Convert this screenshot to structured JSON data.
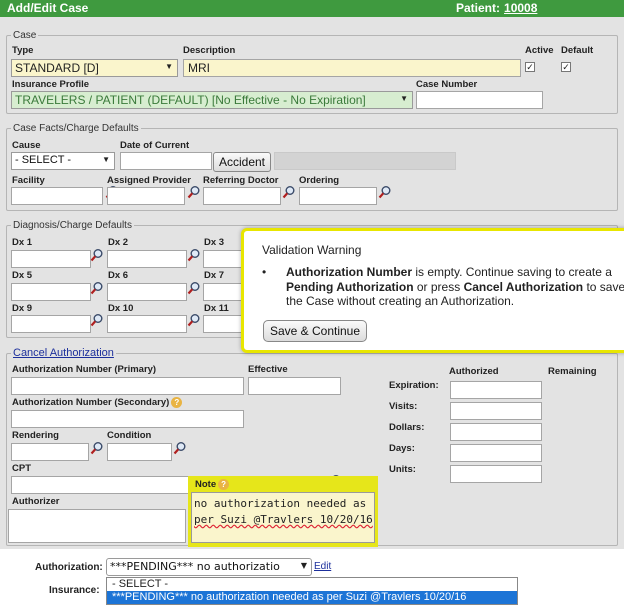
{
  "header": {
    "title": "Add/Edit Case",
    "patient_label": "Patient:",
    "patient_id": "10008"
  },
  "case": {
    "legend": "Case",
    "type_label": "Type",
    "type_value": "STANDARD [D]",
    "description_label": "Description",
    "description_value": "MRI",
    "active_label": "Active",
    "default_label": "Default",
    "active_checked": true,
    "default_checked": true,
    "insurance_profile_label": "Insurance Profile",
    "insurance_profile_value": "TRAVELERS / PATIENT (DEFAULT) [No Effective - No Expiration]",
    "case_number_label": "Case Number",
    "case_number_value": ""
  },
  "facts": {
    "legend": "Case Facts/Charge Defaults",
    "cause_label": "Cause",
    "cause_value": "- SELECT -",
    "date_of_current_label": "Date of Current",
    "accident_button": "Accident",
    "facility_label": "Facility",
    "assigned_provider_label": "Assigned Provider",
    "referring_doctor_label": "Referring Doctor",
    "ordering_label": "Ordering"
  },
  "diagnosis": {
    "legend": "Diagnosis/Charge Defaults",
    "labels": [
      "Dx 1",
      "Dx 2",
      "Dx 3",
      "Dx 5",
      "Dx 6",
      "Dx 7",
      "Dx 9",
      "Dx 10",
      "Dx 11"
    ]
  },
  "authorization": {
    "legend_link": "Cancel Authorization",
    "auth_primary_label": "Authorization Number (Primary)",
    "effective_label": "Effective",
    "auth_secondary_label": "Authorization Number (Secondary)",
    "rendering_label": "Rendering",
    "condition_label": "Condition",
    "cpt_label": "CPT",
    "authorizer_label": "Authorizer",
    "note_label": "Note",
    "note_lines": [
      "no authorization needed as",
      "per Suzi @Travlers 10/20/16"
    ],
    "authorized_label": "Authorized",
    "remaining_label": "Remaining",
    "expiration_label": "Expiration:",
    "visits_label": "Visits:",
    "dollars_label": "Dollars:",
    "days_label": "Days:",
    "units_label": "Units:"
  },
  "warning": {
    "title": "Validation Warning",
    "bullet_strong1": "Authorization Number",
    "bullet_text1": " is empty. Continue saving to create a ",
    "bullet_strong2": "Pending Authorization",
    "bullet_text2": " or press ",
    "bullet_strong3": "Cancel Authorization",
    "bullet_text3": " to save the Case without creating an Authorization.",
    "continue_button": "Save & Continue"
  },
  "bottom": {
    "authorization_label": "Authorization:",
    "authorization_value": "***PENDING*** no authorizatio",
    "edit_link": "Edit",
    "insurance_label": "Insurance:",
    "dropdown_options": [
      "- SELECT -",
      "***PENDING*** no authorization needed as per Suzi @Travlers 10/20/16"
    ]
  }
}
